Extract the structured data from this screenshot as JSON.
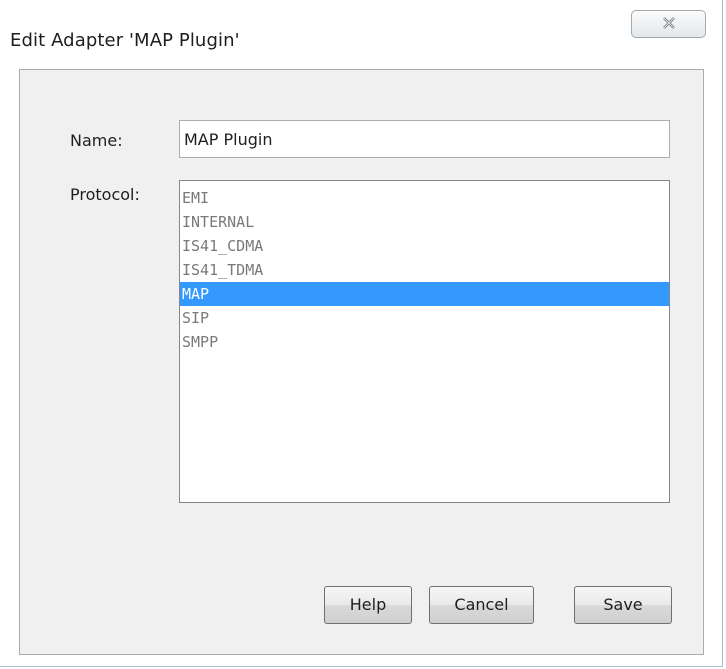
{
  "window": {
    "title": "Edit Adapter 'MAP Plugin'",
    "close_icon": "close-icon"
  },
  "form": {
    "name_label": "Name:",
    "name_value": "MAP Plugin",
    "protocol_label": "Protocol:",
    "protocols": [
      {
        "label": "EMI",
        "selected": false
      },
      {
        "label": "INTERNAL",
        "selected": false
      },
      {
        "label": "IS41_CDMA",
        "selected": false
      },
      {
        "label": "IS41_TDMA",
        "selected": false
      },
      {
        "label": "MAP",
        "selected": true
      },
      {
        "label": "SIP",
        "selected": false
      },
      {
        "label": "SMPP",
        "selected": false
      }
    ],
    "selected_color": "#3399ff"
  },
  "buttons": {
    "help": "Help",
    "cancel": "Cancel",
    "save": "Save"
  }
}
